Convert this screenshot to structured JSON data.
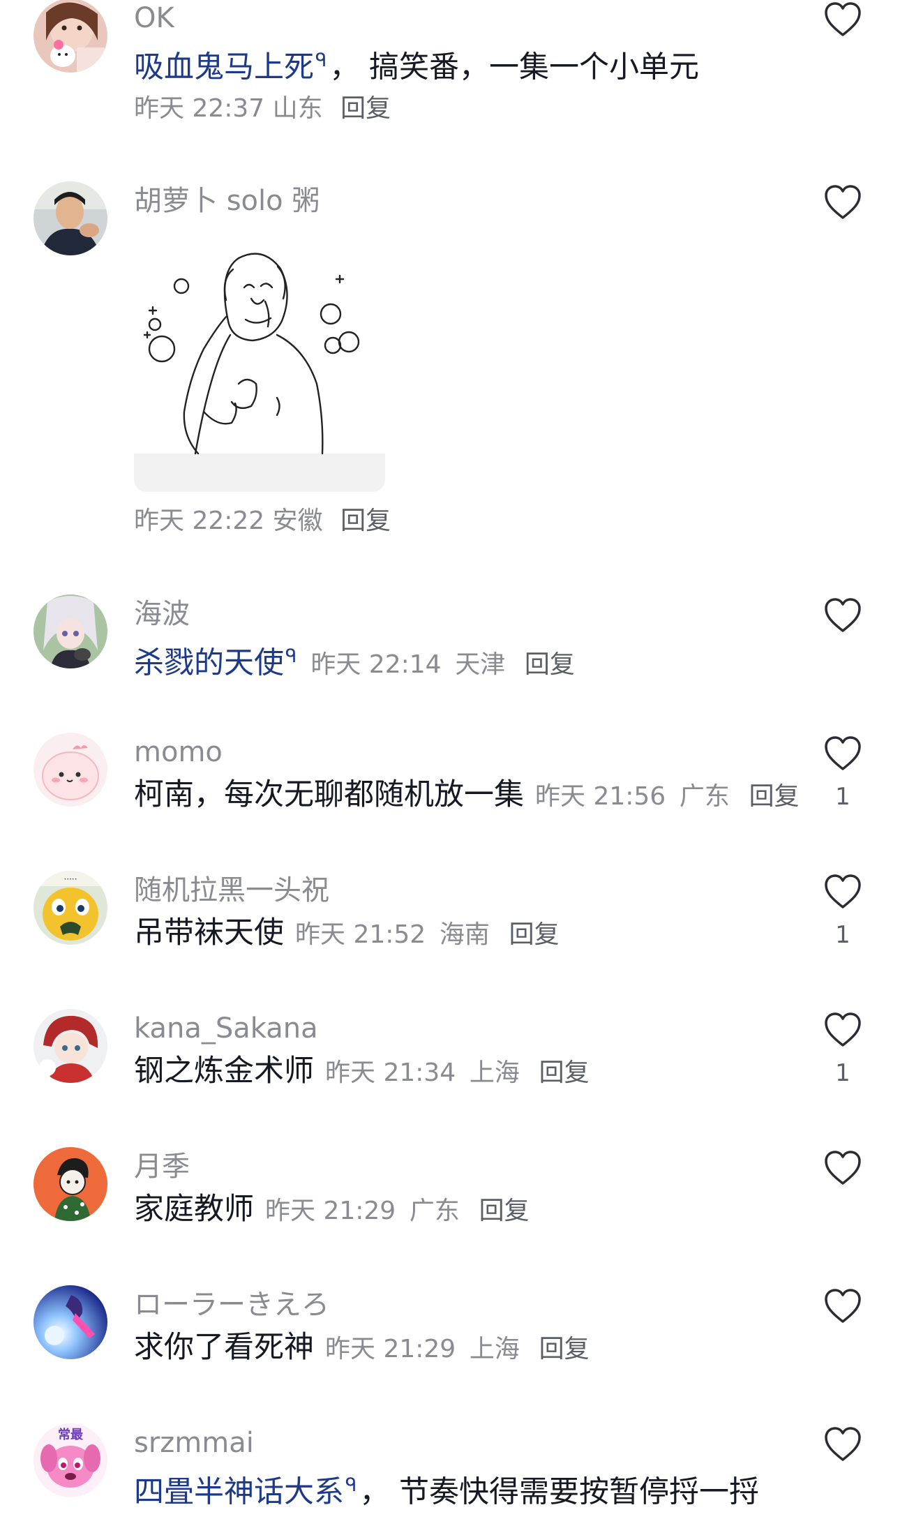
{
  "comments": [
    {
      "username": "OK",
      "segments": [
        {
          "text": "吸血鬼马上死",
          "link": true
        },
        {
          "text": "， 搞笑番，一集一个小单元",
          "link": false
        }
      ],
      "time": "昨天 22:37",
      "location": "山东",
      "reply_label": "回复",
      "likes": "",
      "avatar_icon": "hello-kitty-selfie-avatar"
    },
    {
      "username": "胡萝卜 solo 粥",
      "image": "line-sketch-sticker",
      "time": "昨天 22:22",
      "location": "安徽",
      "reply_label": "回复",
      "likes": "",
      "avatar_icon": "man-photo-avatar"
    },
    {
      "username": "海波",
      "segments": [
        {
          "text": "杀戮的天使",
          "link": true
        }
      ],
      "time": "昨天 22:14",
      "location": "天津",
      "reply_label": "回复",
      "likes": "",
      "avatar_icon": "anime-girl-avatar"
    },
    {
      "username": "momo",
      "segments": [
        {
          "text": "柯南，每次无聊都随机放一集",
          "link": false
        }
      ],
      "time": "昨天 21:56",
      "location": "广东",
      "reply_label": "回复",
      "likes": "1",
      "avatar_icon": "pink-blob-avatar"
    },
    {
      "username": "随机拉黑一头祝",
      "segments": [
        {
          "text": "吊带袜天使",
          "link": false
        }
      ],
      "time": "昨天 21:52",
      "location": "海南",
      "reply_label": "回复",
      "likes": "1",
      "avatar_icon": "yellow-creature-avatar"
    },
    {
      "username": "kana_Sakana",
      "segments": [
        {
          "text": "钢之炼金术师",
          "link": false
        }
      ],
      "time": "昨天 21:34",
      "location": "上海",
      "reply_label": "回复",
      "likes": "1",
      "avatar_icon": "red-hair-chibi-avatar"
    },
    {
      "username": "月季",
      "segments": [
        {
          "text": "家庭教师",
          "link": false
        }
      ],
      "time": "昨天 21:29",
      "location": "广东",
      "reply_label": "回复",
      "likes": "",
      "avatar_icon": "orange-cartoon-avatar"
    },
    {
      "username": "ローラーきえろ",
      "segments": [
        {
          "text": "求你了看死神",
          "link": false
        }
      ],
      "time": "昨天 21:29",
      "location": "上海",
      "reply_label": "回复",
      "likes": "",
      "avatar_icon": "blue-anime-avatar"
    },
    {
      "username": "srzmmai",
      "segments": [
        {
          "text": "四畳半神话大系",
          "link": true
        },
        {
          "text": "， 节奏快得需要按暂停捋一捋",
          "link": false
        }
      ],
      "time": "",
      "location": "",
      "reply_label": "",
      "likes": "",
      "avatar_icon": "pink-dog-avatar"
    }
  ],
  "colors": {
    "link": "#1d3a8a",
    "meta": "#8a8b91",
    "text": "#161823"
  }
}
